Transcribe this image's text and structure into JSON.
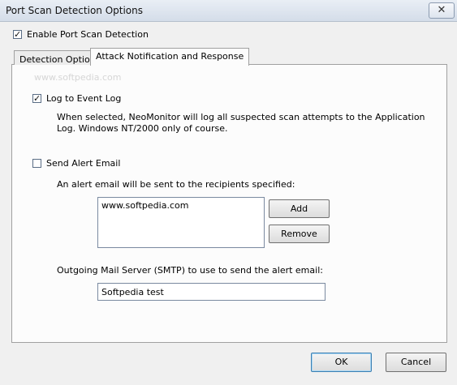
{
  "window": {
    "title": "Port Scan Detection Options",
    "close_glyph": "✕"
  },
  "enable_detection": {
    "label": "Enable Port Scan Detection",
    "checked": true
  },
  "tabs": [
    {
      "label": "Detection Options",
      "active": false
    },
    {
      "label": "Attack Notification and Response",
      "active": true
    }
  ],
  "watermark": "www.softpedia.com",
  "event_log": {
    "label": "Log to Event Log",
    "checked": true,
    "description_line1": "When selected, NeoMonitor will log all suspected scan attempts to the Application",
    "description_line2": "Log.  Windows NT/2000 only of course."
  },
  "alert_email": {
    "label": "Send Alert Email",
    "checked": false,
    "recipients_label": "An alert email will be sent to the recipients specified:",
    "recipients": [
      "www.softpedia.com"
    ],
    "add_label": "Add",
    "remove_label": "Remove",
    "smtp_label": "Outgoing Mail Server (SMTP) to use to send the alert email:",
    "smtp_value": "Softpedia test"
  },
  "buttons": {
    "ok": "OK",
    "cancel": "Cancel"
  }
}
